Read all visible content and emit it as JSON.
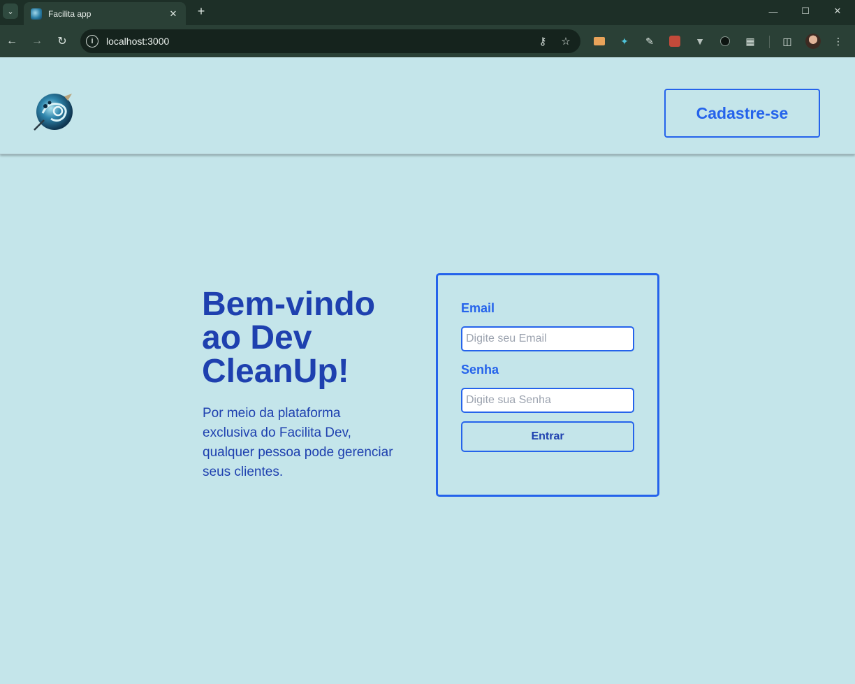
{
  "browser": {
    "tab_title": "Facilita app",
    "url": "localhost:3000",
    "icons": {
      "tab_list": "chevron-down-icon",
      "tab_close": "close-icon",
      "new_tab": "plus-icon",
      "back": "arrow-left-icon",
      "forward": "arrow-right-icon",
      "reload": "reload-icon",
      "site_info": "info-icon",
      "passwords": "key-icon",
      "bookmark": "star-icon",
      "extensions": "puzzle-icon",
      "side_panel": "side-panel-icon",
      "menu": "kebab-menu-icon"
    }
  },
  "header": {
    "logo_icon": "app-logo",
    "signup_label": "Cadastre-se"
  },
  "hero": {
    "title_lines": [
      "Bem-vindo",
      "ao Dev",
      "CleanUp!"
    ],
    "text_lines": [
      "Por meio da plataforma",
      "exclusiva do Facilita Dev,",
      "qualquer pessoa pode gerenciar",
      "seus clientes."
    ]
  },
  "login": {
    "email_label": "Email",
    "email_placeholder": "Digite seu Email",
    "email_value": "",
    "password_label": "Senha",
    "password_placeholder": "Digite sua Senha",
    "password_value": "",
    "submit_label": "Entrar"
  },
  "colors": {
    "page_background": "#c4e5ea",
    "accent": "#2563eb",
    "heading": "#1e40af",
    "browser_frame": "#1d2f27"
  }
}
